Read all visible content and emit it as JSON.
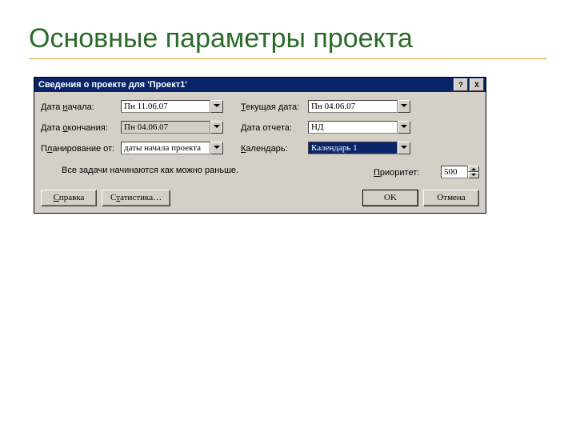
{
  "slide": {
    "title": "Основные параметры проекта"
  },
  "dialog": {
    "title": "Сведения о проекте для 'Проект1'",
    "help_btn": "?",
    "close_btn": "X",
    "labels": {
      "start": "Дата начала:",
      "end": "Дата окончания:",
      "plan": "Планирование от:",
      "current": "Текущая дата:",
      "report": "Дата отчета:",
      "calendar": "Календарь:",
      "priority": "Приоритет:"
    },
    "values": {
      "start": "Пн 11.06.07",
      "end": "Пн 04.06.07",
      "plan": "даты начала проекта",
      "current": "Пн 04.06.07",
      "report": "НД",
      "calendar": "Календарь 1",
      "priority": "500"
    },
    "note": "Все задачи начинаются как можно раньше.",
    "buttons": {
      "help": "Справка",
      "stats": "Статистика…",
      "ok": "OK",
      "cancel": "Отмена"
    }
  }
}
